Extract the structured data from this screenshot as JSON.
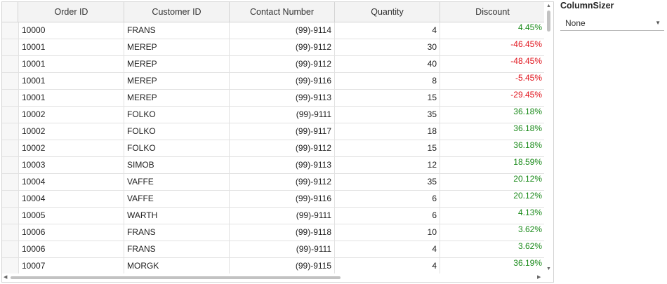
{
  "grid": {
    "columns": [
      {
        "key": "order_id",
        "label": "Order ID",
        "align": "left"
      },
      {
        "key": "customer_id",
        "label": "Customer ID",
        "align": "left"
      },
      {
        "key": "contact",
        "label": "Contact Number",
        "align": "right"
      },
      {
        "key": "quantity",
        "label": "Quantity",
        "align": "right"
      },
      {
        "key": "discount",
        "label": "Discount",
        "align": "right"
      }
    ],
    "rows": [
      {
        "order_id": "10000",
        "customer_id": "FRANS",
        "contact": "(99)-9114",
        "quantity": "4",
        "discount": "4.45%",
        "sign": "pos"
      },
      {
        "order_id": "10001",
        "customer_id": "MEREP",
        "contact": "(99)-9112",
        "quantity": "30",
        "discount": "-46.45%",
        "sign": "neg"
      },
      {
        "order_id": "10001",
        "customer_id": "MEREP",
        "contact": "(99)-9112",
        "quantity": "40",
        "discount": "-48.45%",
        "sign": "neg"
      },
      {
        "order_id": "10001",
        "customer_id": "MEREP",
        "contact": "(99)-9116",
        "quantity": "8",
        "discount": "-5.45%",
        "sign": "neg"
      },
      {
        "order_id": "10001",
        "customer_id": "MEREP",
        "contact": "(99)-9113",
        "quantity": "15",
        "discount": "-29.45%",
        "sign": "neg"
      },
      {
        "order_id": "10002",
        "customer_id": "FOLKO",
        "contact": "(99)-9111",
        "quantity": "35",
        "discount": "36.18%",
        "sign": "pos"
      },
      {
        "order_id": "10002",
        "customer_id": "FOLKO",
        "contact": "(99)-9117",
        "quantity": "18",
        "discount": "36.18%",
        "sign": "pos"
      },
      {
        "order_id": "10002",
        "customer_id": "FOLKO",
        "contact": "(99)-9112",
        "quantity": "15",
        "discount": "36.18%",
        "sign": "pos"
      },
      {
        "order_id": "10003",
        "customer_id": "SIMOB",
        "contact": "(99)-9113",
        "quantity": "12",
        "discount": "18.59%",
        "sign": "pos"
      },
      {
        "order_id": "10004",
        "customer_id": "VAFFE",
        "contact": "(99)-9112",
        "quantity": "35",
        "discount": "20.12%",
        "sign": "pos"
      },
      {
        "order_id": "10004",
        "customer_id": "VAFFE",
        "contact": "(99)-9116",
        "quantity": "6",
        "discount": "20.12%",
        "sign": "pos"
      },
      {
        "order_id": "10005",
        "customer_id": "WARTH",
        "contact": "(99)-9111",
        "quantity": "6",
        "discount": "4.13%",
        "sign": "pos"
      },
      {
        "order_id": "10006",
        "customer_id": "FRANS",
        "contact": "(99)-9118",
        "quantity": "10",
        "discount": "3.62%",
        "sign": "pos"
      },
      {
        "order_id": "10006",
        "customer_id": "FRANS",
        "contact": "(99)-9111",
        "quantity": "4",
        "discount": "3.62%",
        "sign": "pos"
      },
      {
        "order_id": "10007",
        "customer_id": "MORGK",
        "contact": "(99)-9115",
        "quantity": "4",
        "discount": "36.19%",
        "sign": "pos"
      }
    ]
  },
  "colors": {
    "positive": "#1a8a1a",
    "negative": "#e0121b",
    "header_bg": "#f3f3f3",
    "border": "#d4d4d4"
  },
  "panel": {
    "title": "ColumnSizer",
    "selected": "None"
  },
  "icons": {
    "dropdown": "chevron-down-icon",
    "scroll_up": "triangle-up-icon",
    "scroll_down": "triangle-down-icon",
    "scroll_left": "triangle-left-icon",
    "scroll_right": "triangle-right-icon"
  }
}
